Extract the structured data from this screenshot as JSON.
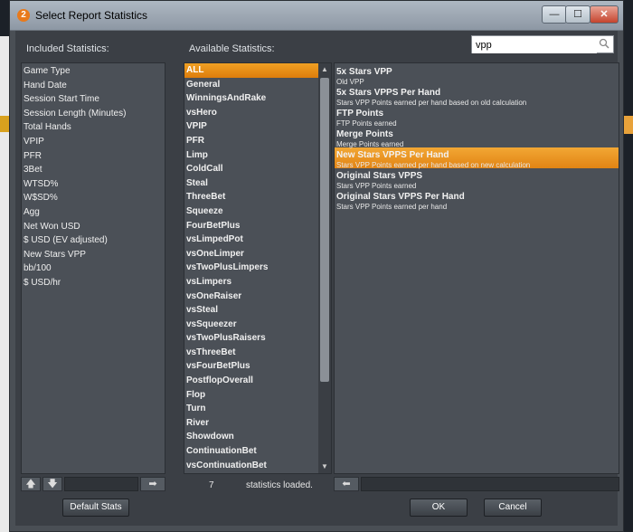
{
  "window": {
    "title": "Select Report Statistics",
    "app_icon_glyph": "2",
    "controls": {
      "minimize": "—",
      "maximize": "☐",
      "close": "✕"
    }
  },
  "labels": {
    "included": "Included Statistics:",
    "available": "Available Statistics:"
  },
  "search": {
    "value": "vpp",
    "placeholder": ""
  },
  "included": [
    "Game Type",
    "Hand Date",
    "Session Start Time",
    "Session Length (Minutes)",
    "Total Hands",
    "VPIP",
    "PFR",
    "3Bet",
    "WTSD%",
    "W$SD%",
    "Agg",
    "Net Won USD",
    "$ USD (EV adjusted)",
    "New Stars VPP",
    "bb/100",
    "$ USD/hr"
  ],
  "available": [
    "ALL",
    "General",
    "WinningsAndRake",
    "vsHero",
    "VPIP",
    "PFR",
    "Limp",
    "ColdCall",
    "Steal",
    "ThreeBet",
    "Squeeze",
    "FourBetPlus",
    "vsLimpedPot",
    "vsOneLimper",
    "vsTwoPlusLimpers",
    "vsLimpers",
    "vsOneRaiser",
    "vsSteal",
    "vsSqueezer",
    "vsTwoPlusRaisers",
    "vsThreeBet",
    "vsFourBetPlus",
    "PostflopOverall",
    "Flop",
    "Turn",
    "River",
    "Showdown",
    "ContinuationBet",
    "vsContinuationBet"
  ],
  "available_selected": "ALL",
  "results": [
    {
      "title": "5x Stars VPP",
      "desc": "Old VPP"
    },
    {
      "title": "5x Stars VPPS Per Hand",
      "desc": "Stars VPP Points earned per hand based on old calculation"
    },
    {
      "title": "FTP Points",
      "desc": "FTP Points earned"
    },
    {
      "title": "Merge Points",
      "desc": "Merge Points earned"
    },
    {
      "title": "New Stars VPPS Per Hand",
      "desc": "Stars VPP Points earned per hand based on new calculation"
    },
    {
      "title": "Original Stars VPPS",
      "desc": "Stars VPP Points earned"
    },
    {
      "title": "Original Stars VPPS Per Hand",
      "desc": "Stars VPP Points earned per hand"
    }
  ],
  "results_selected": "New Stars VPPS Per Hand",
  "status": {
    "count": "7",
    "text": "statistics loaded."
  },
  "buttons": {
    "default_stats": "Default Stats",
    "ok": "OK",
    "cancel": "Cancel"
  },
  "icons": {
    "move_up": "🡅",
    "move_down": "🡇",
    "move_right": "➡",
    "move_left": "⬅",
    "scroll_up": "▲",
    "scroll_down": "▼"
  },
  "colors": {
    "accent": "#e88a12",
    "panel": "#4b5057",
    "window": "#3b3f45"
  }
}
